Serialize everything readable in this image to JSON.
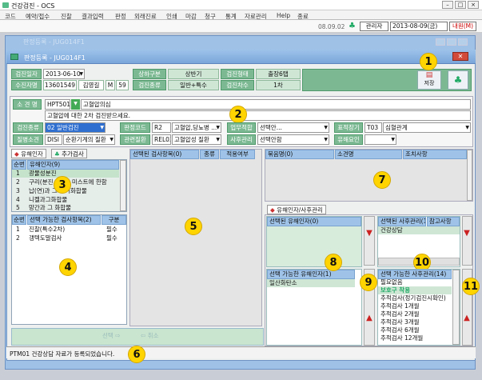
{
  "window": {
    "title": "건강검진 - OCS"
  },
  "menu": [
    "코드",
    "예약/접수",
    "진찰",
    "결과입력",
    "판정",
    "외래진료",
    "인쇄",
    "마감",
    "청구",
    "통계",
    "자료관리",
    "Help",
    "종료"
  ],
  "toolbar": {
    "date": "08.09.02",
    "admin": "관리자",
    "date2": "2013-08-09(금)",
    "logout": "내원(M)"
  },
  "inner_window": {
    "title": "판정등록 - JUG014F1",
    "bg_title": "판정등록 - JUG014F1"
  },
  "info": {
    "exam_date_label": "검진일자",
    "exam_date": "2013-06-10",
    "half_label": "상하구분",
    "half": "상반기",
    "exam_type_label": "검진형태",
    "exam_type": "출장6탭",
    "receipt_label": "수진자명",
    "receipt_no": "13601549",
    "name": "김영길",
    "sex": "M",
    "age": "59",
    "kind_label": "검진종류",
    "kind": "일반+특수",
    "round_label": "검진차수",
    "round": "1차"
  },
  "save_button": "저장",
  "finding": {
    "label": "소 견 명",
    "code": "HPT501",
    "name": "고혈압의심",
    "comment": "고혈압에 대한 2차 검진받으세요."
  },
  "row3": {
    "kind_label": "검진종류",
    "kind_value": "02 일반검진",
    "judge_label": "판정코드",
    "judge_code": "R2",
    "judge_value": "고혈압,당뇨병 ...",
    "fit_label": "업무적합",
    "fit_value": "선택안...",
    "organ_label": "표적장기",
    "organ_code": "T03",
    "organ_value": "심혈관계"
  },
  "row4": {
    "disease_label": "질병소견",
    "disease_code": "DISI",
    "disease_value": "순환기계의 질환",
    "rel_label": "관련질환",
    "rel_code": "REL03",
    "rel_value": "고혈압성 질환",
    "after_label": "사후관리",
    "after_value": "선택안함",
    "harm_label": "유해요인"
  },
  "left_tabs": [
    "유해인자",
    "추가검사"
  ],
  "harm_table": {
    "headers": [
      "순번",
      "유해인자(9)"
    ],
    "rows": [
      [
        "1",
        "광물성분진"
      ],
      [
        "2",
        "구리(분진, 흄 및 미스트에 한함"
      ],
      [
        "3",
        "납(연)과 그 무기화합물"
      ],
      [
        "4",
        "니켈과그화합물"
      ],
      [
        "5",
        "망간과 그 화합물"
      ]
    ]
  },
  "avail_table": {
    "headers": [
      "순번",
      "선택 가능한 검사항목(2)",
      "구분"
    ],
    "rows": [
      [
        "1",
        "진찰(특수2차)",
        "필수"
      ],
      [
        "2",
        "갱텍도말검사",
        "필수"
      ]
    ]
  },
  "selected_table": {
    "headers": [
      "선택된 검사항목(0)",
      "종류",
      "적용여부"
    ]
  },
  "buttons": {
    "select": "선택",
    "cancel": "취소"
  },
  "bundle_table": {
    "headers": [
      "묶음명(0)",
      "소견명",
      "조치사항"
    ]
  },
  "bottom_tab": "유해인자/사후관리",
  "sel_harm_header": "선택된 유해인자(0)",
  "avail_harm_header": "선택 가능한 유해인자(1)",
  "avail_harm_rows": [
    "일산화탄소"
  ],
  "sel_after_headers": [
    "선택된 사후관리(1)",
    "참고사항"
  ],
  "sel_after_rows": [
    "건강상담"
  ],
  "avail_after_header": "선택 가능한 사후관리(14)",
  "avail_after_rows": [
    "필요없음",
    "보호구 착용",
    "추적검사(정기검진시확인)",
    "추적검사 1개월",
    "추적검사 2개월",
    "추적검사 3개월",
    "추적검사 6개월",
    "추적검사 12개월"
  ],
  "status": "PTM01 건강상담 자료가 등록되었습니다.",
  "callouts": [
    "1",
    "2",
    "3",
    "4",
    "5",
    "6",
    "7",
    "8",
    "9",
    "10",
    "11"
  ],
  "colors": {
    "callout": "#ffd400",
    "header": "#9fc3e8",
    "label_green": "#7cb993"
  }
}
